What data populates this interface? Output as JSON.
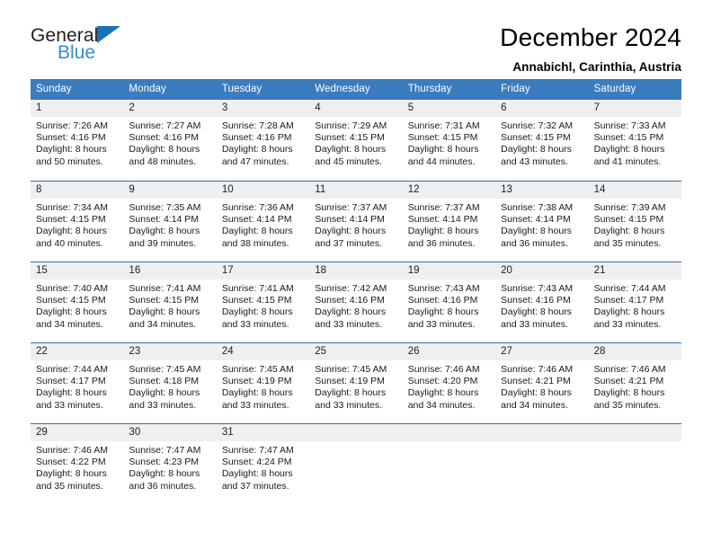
{
  "logo": {
    "word_top": "General",
    "word_bottom": "Blue",
    "triangle_color": "#1b72b8",
    "bottom_color": "#2e8ed4"
  },
  "header": {
    "title": "December 2024",
    "subtitle": "Annabichl, Carinthia, Austria"
  },
  "theme": {
    "header_bg": "#3a7cbe",
    "header_text": "#ffffff",
    "daynum_bg": "#efefef",
    "cell_bg": "#ffffff",
    "row_divider": "#2f6fae"
  },
  "weekdays": [
    "Sunday",
    "Monday",
    "Tuesday",
    "Wednesday",
    "Thursday",
    "Friday",
    "Saturday"
  ],
  "weeks": [
    [
      {
        "day": "1",
        "sunrise": "Sunrise: 7:26 AM",
        "sunset": "Sunset: 4:16 PM",
        "daylight1": "Daylight: 8 hours",
        "daylight2": "and 50 minutes."
      },
      {
        "day": "2",
        "sunrise": "Sunrise: 7:27 AM",
        "sunset": "Sunset: 4:16 PM",
        "daylight1": "Daylight: 8 hours",
        "daylight2": "and 48 minutes."
      },
      {
        "day": "3",
        "sunrise": "Sunrise: 7:28 AM",
        "sunset": "Sunset: 4:16 PM",
        "daylight1": "Daylight: 8 hours",
        "daylight2": "and 47 minutes."
      },
      {
        "day": "4",
        "sunrise": "Sunrise: 7:29 AM",
        "sunset": "Sunset: 4:15 PM",
        "daylight1": "Daylight: 8 hours",
        "daylight2": "and 45 minutes."
      },
      {
        "day": "5",
        "sunrise": "Sunrise: 7:31 AM",
        "sunset": "Sunset: 4:15 PM",
        "daylight1": "Daylight: 8 hours",
        "daylight2": "and 44 minutes."
      },
      {
        "day": "6",
        "sunrise": "Sunrise: 7:32 AM",
        "sunset": "Sunset: 4:15 PM",
        "daylight1": "Daylight: 8 hours",
        "daylight2": "and 43 minutes."
      },
      {
        "day": "7",
        "sunrise": "Sunrise: 7:33 AM",
        "sunset": "Sunset: 4:15 PM",
        "daylight1": "Daylight: 8 hours",
        "daylight2": "and 41 minutes."
      }
    ],
    [
      {
        "day": "8",
        "sunrise": "Sunrise: 7:34 AM",
        "sunset": "Sunset: 4:15 PM",
        "daylight1": "Daylight: 8 hours",
        "daylight2": "and 40 minutes."
      },
      {
        "day": "9",
        "sunrise": "Sunrise: 7:35 AM",
        "sunset": "Sunset: 4:14 PM",
        "daylight1": "Daylight: 8 hours",
        "daylight2": "and 39 minutes."
      },
      {
        "day": "10",
        "sunrise": "Sunrise: 7:36 AM",
        "sunset": "Sunset: 4:14 PM",
        "daylight1": "Daylight: 8 hours",
        "daylight2": "and 38 minutes."
      },
      {
        "day": "11",
        "sunrise": "Sunrise: 7:37 AM",
        "sunset": "Sunset: 4:14 PM",
        "daylight1": "Daylight: 8 hours",
        "daylight2": "and 37 minutes."
      },
      {
        "day": "12",
        "sunrise": "Sunrise: 7:37 AM",
        "sunset": "Sunset: 4:14 PM",
        "daylight1": "Daylight: 8 hours",
        "daylight2": "and 36 minutes."
      },
      {
        "day": "13",
        "sunrise": "Sunrise: 7:38 AM",
        "sunset": "Sunset: 4:14 PM",
        "daylight1": "Daylight: 8 hours",
        "daylight2": "and 36 minutes."
      },
      {
        "day": "14",
        "sunrise": "Sunrise: 7:39 AM",
        "sunset": "Sunset: 4:15 PM",
        "daylight1": "Daylight: 8 hours",
        "daylight2": "and 35 minutes."
      }
    ],
    [
      {
        "day": "15",
        "sunrise": "Sunrise: 7:40 AM",
        "sunset": "Sunset: 4:15 PM",
        "daylight1": "Daylight: 8 hours",
        "daylight2": "and 34 minutes."
      },
      {
        "day": "16",
        "sunrise": "Sunrise: 7:41 AM",
        "sunset": "Sunset: 4:15 PM",
        "daylight1": "Daylight: 8 hours",
        "daylight2": "and 34 minutes."
      },
      {
        "day": "17",
        "sunrise": "Sunrise: 7:41 AM",
        "sunset": "Sunset: 4:15 PM",
        "daylight1": "Daylight: 8 hours",
        "daylight2": "and 33 minutes."
      },
      {
        "day": "18",
        "sunrise": "Sunrise: 7:42 AM",
        "sunset": "Sunset: 4:16 PM",
        "daylight1": "Daylight: 8 hours",
        "daylight2": "and 33 minutes."
      },
      {
        "day": "19",
        "sunrise": "Sunrise: 7:43 AM",
        "sunset": "Sunset: 4:16 PM",
        "daylight1": "Daylight: 8 hours",
        "daylight2": "and 33 minutes."
      },
      {
        "day": "20",
        "sunrise": "Sunrise: 7:43 AM",
        "sunset": "Sunset: 4:16 PM",
        "daylight1": "Daylight: 8 hours",
        "daylight2": "and 33 minutes."
      },
      {
        "day": "21",
        "sunrise": "Sunrise: 7:44 AM",
        "sunset": "Sunset: 4:17 PM",
        "daylight1": "Daylight: 8 hours",
        "daylight2": "and 33 minutes."
      }
    ],
    [
      {
        "day": "22",
        "sunrise": "Sunrise: 7:44 AM",
        "sunset": "Sunset: 4:17 PM",
        "daylight1": "Daylight: 8 hours",
        "daylight2": "and 33 minutes."
      },
      {
        "day": "23",
        "sunrise": "Sunrise: 7:45 AM",
        "sunset": "Sunset: 4:18 PM",
        "daylight1": "Daylight: 8 hours",
        "daylight2": "and 33 minutes."
      },
      {
        "day": "24",
        "sunrise": "Sunrise: 7:45 AM",
        "sunset": "Sunset: 4:19 PM",
        "daylight1": "Daylight: 8 hours",
        "daylight2": "and 33 minutes."
      },
      {
        "day": "25",
        "sunrise": "Sunrise: 7:45 AM",
        "sunset": "Sunset: 4:19 PM",
        "daylight1": "Daylight: 8 hours",
        "daylight2": "and 33 minutes."
      },
      {
        "day": "26",
        "sunrise": "Sunrise: 7:46 AM",
        "sunset": "Sunset: 4:20 PM",
        "daylight1": "Daylight: 8 hours",
        "daylight2": "and 34 minutes."
      },
      {
        "day": "27",
        "sunrise": "Sunrise: 7:46 AM",
        "sunset": "Sunset: 4:21 PM",
        "daylight1": "Daylight: 8 hours",
        "daylight2": "and 34 minutes."
      },
      {
        "day": "28",
        "sunrise": "Sunrise: 7:46 AM",
        "sunset": "Sunset: 4:21 PM",
        "daylight1": "Daylight: 8 hours",
        "daylight2": "and 35 minutes."
      }
    ],
    [
      {
        "day": "29",
        "sunrise": "Sunrise: 7:46 AM",
        "sunset": "Sunset: 4:22 PM",
        "daylight1": "Daylight: 8 hours",
        "daylight2": "and 35 minutes."
      },
      {
        "day": "30",
        "sunrise": "Sunrise: 7:47 AM",
        "sunset": "Sunset: 4:23 PM",
        "daylight1": "Daylight: 8 hours",
        "daylight2": "and 36 minutes."
      },
      {
        "day": "31",
        "sunrise": "Sunrise: 7:47 AM",
        "sunset": "Sunset: 4:24 PM",
        "daylight1": "Daylight: 8 hours",
        "daylight2": "and 37 minutes."
      },
      {
        "day": "",
        "sunrise": "",
        "sunset": "",
        "daylight1": "",
        "daylight2": ""
      },
      {
        "day": "",
        "sunrise": "",
        "sunset": "",
        "daylight1": "",
        "daylight2": ""
      },
      {
        "day": "",
        "sunrise": "",
        "sunset": "",
        "daylight1": "",
        "daylight2": ""
      },
      {
        "day": "",
        "sunrise": "",
        "sunset": "",
        "daylight1": "",
        "daylight2": ""
      }
    ]
  ]
}
